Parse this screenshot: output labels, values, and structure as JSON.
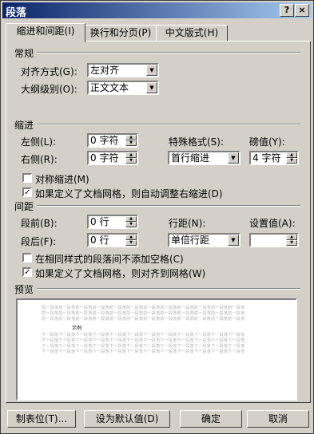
{
  "window": {
    "title": "段落",
    "help_label": "?",
    "close_label": "×"
  },
  "tabs": [
    {
      "label": "缩进和间距(I)"
    },
    {
      "label": "换行和分页(P)"
    },
    {
      "label": "中文版式(H)"
    }
  ],
  "general": {
    "heading": "常规",
    "alignment_label": "对齐方式(G):",
    "alignment_value": "左对齐",
    "outline_label": "大纲级别(O):",
    "outline_value": "正文文本"
  },
  "indent": {
    "heading": "缩进",
    "left_label": "左侧(L):",
    "left_value": "0 字符",
    "right_label": "右侧(R):",
    "right_value": "0 字符",
    "special_label": "特殊格式(S):",
    "special_value": "首行缩进",
    "by_label": "磅值(Y):",
    "by_value": "4 字符",
    "mirror_label": "对称缩进(M)",
    "mirror_checked": false,
    "auto_adjust_label": "如果定义了文档网格，则自动调整右缩进(D)",
    "auto_adjust_checked": true
  },
  "spacing": {
    "heading": "间距",
    "before_label": "段前(B):",
    "before_value": "0 行",
    "after_label": "段后(F):",
    "after_value": "0 行",
    "line_label": "行距(N):",
    "line_value": "单倍行距",
    "at_label": "设置值(A):",
    "at_value": "",
    "no_space_label": "在相同样式的段落间不添加空格(C)",
    "no_space_checked": false,
    "snap_grid_label": "如果定义了文档网格，则对齐到网格(W)",
    "snap_grid_checked": true
  },
  "preview": {
    "heading": "预览",
    "sample_text": "示例",
    "before_line": "前一段落前一段落前一段落前一段落前一段落前一段落前一段落前一段落前一段落前一段落前一段落前一段落",
    "after_line": "下一段落下一段落下一段落下一段落下一段落下一段落下一段落下一段落下一段落下一段落下一段落下一段落"
  },
  "buttons": {
    "tabs_label": "制表位(T)...",
    "default_label": "设为默认值(D)",
    "ok_label": "确定",
    "cancel_label": "取消"
  }
}
